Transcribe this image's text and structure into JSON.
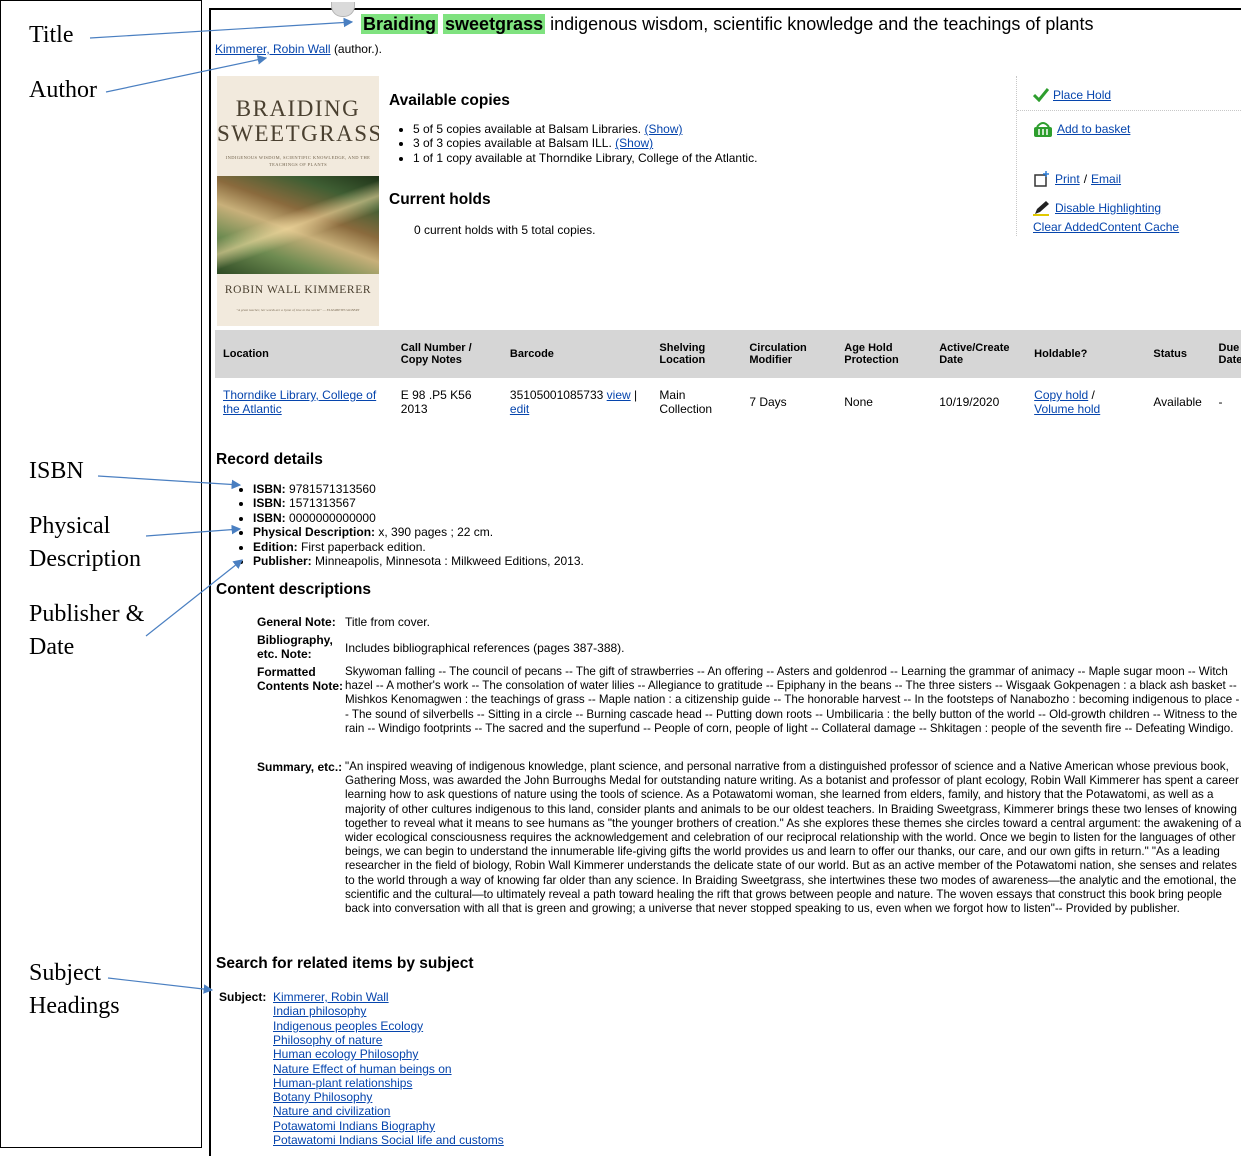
{
  "annotations": {
    "labels": [
      "Title",
      "Author",
      "ISBN",
      "Physical Description",
      "Publisher & Date",
      "Subject Headings"
    ]
  },
  "record": {
    "title_hl1": "Braiding",
    "title_hl2": "sweetgrass",
    "title_rest": "indigenous wisdom, scientific knowledge and the teachings of plants",
    "author_link": "Kimmerer, Robin Wall",
    "author_role": "(author.)."
  },
  "cover": {
    "title": "BRAIDING SWEETGRASS",
    "subtitle": "INDIGENOUS WISDOM, SCIENTIFIC KNOWLEDGE, AND THE TEACHINGS OF PLANTS",
    "author": "ROBIN WALL KIMMERER",
    "quote": "\"A great teacher, her words are a hymn of love to the world.\" — ELIZABETH GILBERT"
  },
  "availability": {
    "heading": "Available copies",
    "items": [
      {
        "text": "5 of 5 copies available at Balsam Libraries.",
        "link": "(Show)"
      },
      {
        "text": "3 of 3 copies available at Balsam ILL.",
        "link": "(Show)"
      },
      {
        "text": "1 of 1 copy available at Thorndike Library, College of the Atlantic.",
        "link": ""
      }
    ],
    "holds_heading": "Current holds",
    "holds_text": "0 current holds with 5 total copies."
  },
  "actions": {
    "place_hold": "Place Hold",
    "add_basket": "Add to basket",
    "print": "Print",
    "sep": " / ",
    "email": "Email",
    "disable_hl": "Disable Highlighting",
    "clear_cache": "Clear AddedContent Cache",
    "colors": {
      "check": "#2e9e2e",
      "basket": "#2e9e2e"
    }
  },
  "copies_table": {
    "headers": [
      "Location",
      "Call Number / Copy Notes",
      "Barcode",
      "Shelving Location",
      "Circulation Modifier",
      "Age Hold Protection",
      "Active/Create Date",
      "Holdable?",
      "Status",
      "Due Date"
    ],
    "row": {
      "location": "Thorndike Library, College of the Atlantic",
      "call_number": "E 98 .P5 K56 2013",
      "barcode": "35105001085733",
      "view": "view",
      "pipe": "|",
      "edit": "edit",
      "shelving": "Main Collection",
      "circ": "7 Days",
      "age_hold": "None",
      "date": "10/19/2020",
      "copy_hold": "Copy hold",
      "slash": " /",
      "volume_hold": "Volume hold",
      "status": "Available",
      "due": "-"
    }
  },
  "details": {
    "heading": "Record details",
    "items": [
      {
        "k": "ISBN:",
        "v": "9781571313560"
      },
      {
        "k": "ISBN:",
        "v": "1571313567"
      },
      {
        "k": "ISBN:",
        "v": "0000000000000"
      },
      {
        "k": "Physical Description:",
        "v": "x, 390 pages ; 22 cm."
      },
      {
        "k": "Edition:",
        "v": "First paperback edition."
      },
      {
        "k": "Publisher:",
        "v": "Minneapolis, Minnesota : Milkweed Editions, 2013."
      }
    ]
  },
  "content": {
    "heading": "Content descriptions",
    "general_k": "General Note:",
    "general_v": "Title from cover.",
    "biblio_k": "Bibliography, etc. Note:",
    "biblio_v": "Includes bibliographical references (pages 387-388).",
    "formatted_k": "Formatted Contents Note:",
    "formatted_v": "Skywoman falling -- The council of pecans -- The gift of strawberries -- An offering -- Asters and goldenrod -- Learning the grammar of animacy -- Maple sugar moon -- Witch hazel -- A mother's work -- The consolation of water lilies -- Allegiance to gratitude -- Epiphany in the beans -- The three sisters -- Wisgaak Gokpenagen : a black ash basket -- Mishkos Kenomagwen : the teachings of grass -- Maple nation : a citizenship guide -- The honorable harvest -- In the footsteps of Nanabozho : becoming indigenous to place -- The sound of silverbells -- Sitting in a circle -- Burning cascade head -- Putting down roots -- Umbilicaria : the belly button of the world -- Old-growth children -- Witness to the rain -- Windigo footprints -- The sacred and the superfund -- People of corn, people of light -- Collateral damage -- Shkitagen : people of the seventh fire -- Defeating Windigo.",
    "summary_k": "Summary, etc.:",
    "summary_v": "\"An inspired weaving of indigenous knowledge, plant science, and personal narrative from a distinguished professor of science and a Native American whose previous book, Gathering Moss, was awarded the John Burroughs Medal for outstanding nature writing. As a botanist and professor of plant ecology, Robin Wall Kimmerer has spent a career learning how to ask questions of nature using the tools of science. As a Potawatomi woman, she learned from elders, family, and history that the Potawatomi, as well as a majority of other cultures indigenous to this land, consider plants and animals to be our oldest teachers. In Braiding Sweetgrass, Kimmerer brings these two lenses of knowing together to reveal what it means to see humans as \"the younger brothers of creation.\" As she explores these themes she circles toward a central argument: the awakening of a wider ecological consciousness requires the acknowledgement and celebration of our reciprocal relationship with the world. Once we begin to listen for the languages of other beings, we can begin to understand the innumerable life-giving gifts the world provides us and learn to offer our thanks, our care, and our own gifts in return.\" \"As a leading researcher in the field of biology, Robin Wall Kimmerer understands the delicate state of our world. But as an active member of the Potawatomi nation, she senses and relates to the world through a way of knowing far older than any science. In Braiding Sweetgrass, she intertwines these two modes of awareness—the analytic and the emotional, the scientific and the cultural—to ultimately reveal a path toward healing the rift that grows between people and nature. The woven essays that construct this book bring people back into conversation with all that is green and growing; a universe that never stopped speaking to us, even when we forgot how to listen\"-- Provided by publisher."
  },
  "subjects": {
    "heading": "Search for related items by subject",
    "label": "Subject:",
    "items": [
      "Kimmerer, Robin Wall",
      "Indian philosophy",
      "Indigenous peoples Ecology",
      "Philosophy of nature",
      "Human ecology Philosophy",
      "Nature Effect of human beings on",
      "Human-plant relationships",
      "Botany Philosophy",
      "Nature and civilization",
      "Potawatomi Indians Biography",
      "Potawatomi Indians Social life and customs"
    ]
  }
}
